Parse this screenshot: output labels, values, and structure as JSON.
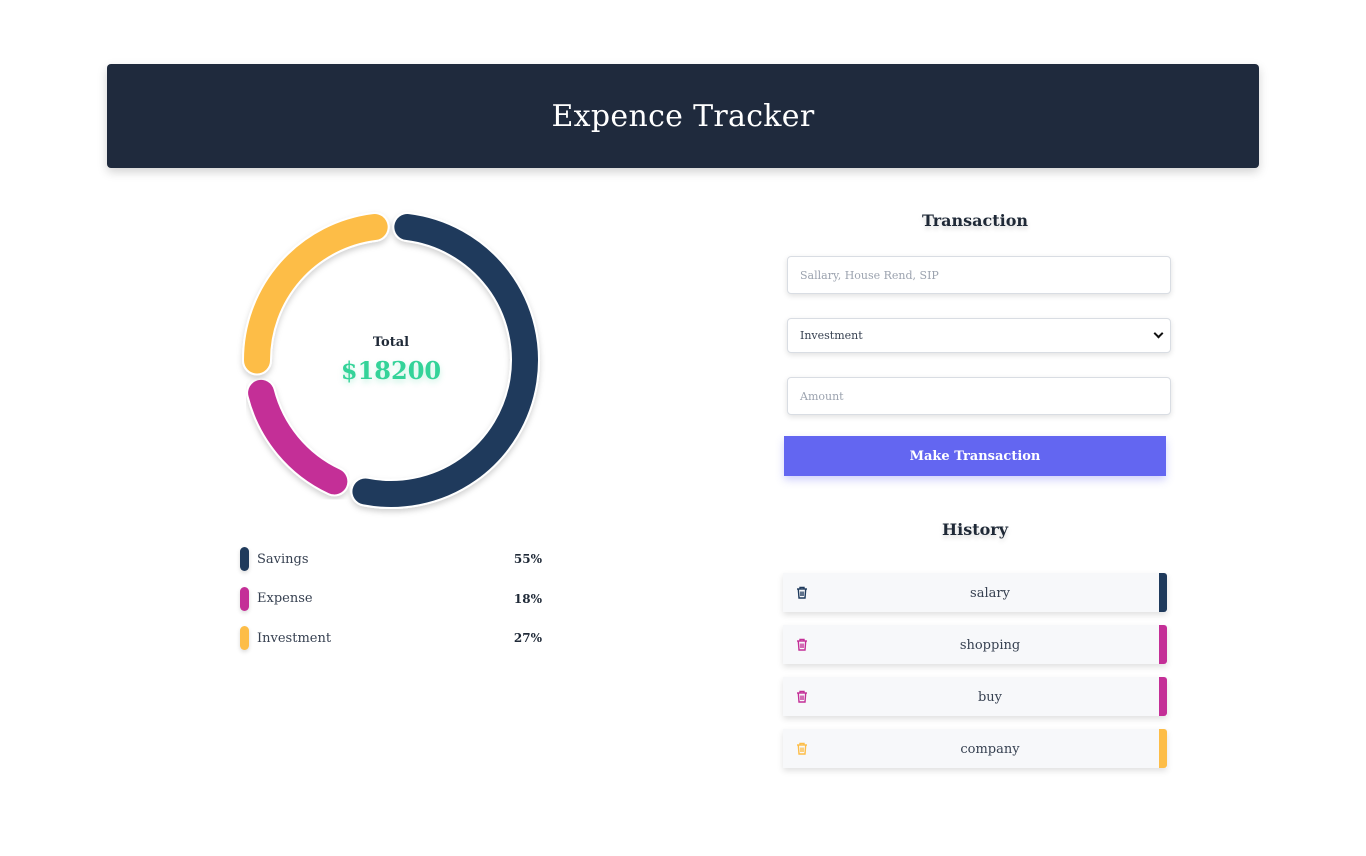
{
  "header": {
    "title": "Expence Tracker"
  },
  "summary": {
    "total_label": "Total",
    "total_value": "$18200"
  },
  "colors": {
    "savings": "#1f3a5c",
    "expense": "#c42f97",
    "investment": "#fdbd47",
    "accent_green": "#34d399",
    "button": "#6366f1"
  },
  "legend": [
    {
      "label": "Savings",
      "percent": "55%",
      "color": "#1f3a5c"
    },
    {
      "label": "Expense",
      "percent": "18%",
      "color": "#c42f97"
    },
    {
      "label": "Investment",
      "percent": "27%",
      "color": "#fdbd47"
    }
  ],
  "donut": [
    {
      "name": "Savings",
      "fraction": 0.55,
      "color": "#1f3a5c"
    },
    {
      "name": "Expense",
      "fraction": 0.18,
      "color": "#c42f97"
    },
    {
      "name": "Investment",
      "fraction": 0.27,
      "color": "#fdbd47"
    }
  ],
  "transaction": {
    "title": "Transaction",
    "name_placeholder": "Sallary, House Rend, SIP",
    "type_selected": "Investment",
    "amount_placeholder": "Amount",
    "submit_label": "Make Transaction"
  },
  "history": {
    "title": "History",
    "items": [
      {
        "name": "salary",
        "color": "#1f3a5c",
        "icon": "trash-icon"
      },
      {
        "name": "shopping",
        "color": "#c42f97",
        "icon": "trash-icon"
      },
      {
        "name": "buy",
        "color": "#c42f97",
        "icon": "trash-icon"
      },
      {
        "name": "company",
        "color": "#fdbd47",
        "icon": "trash-icon"
      }
    ]
  }
}
